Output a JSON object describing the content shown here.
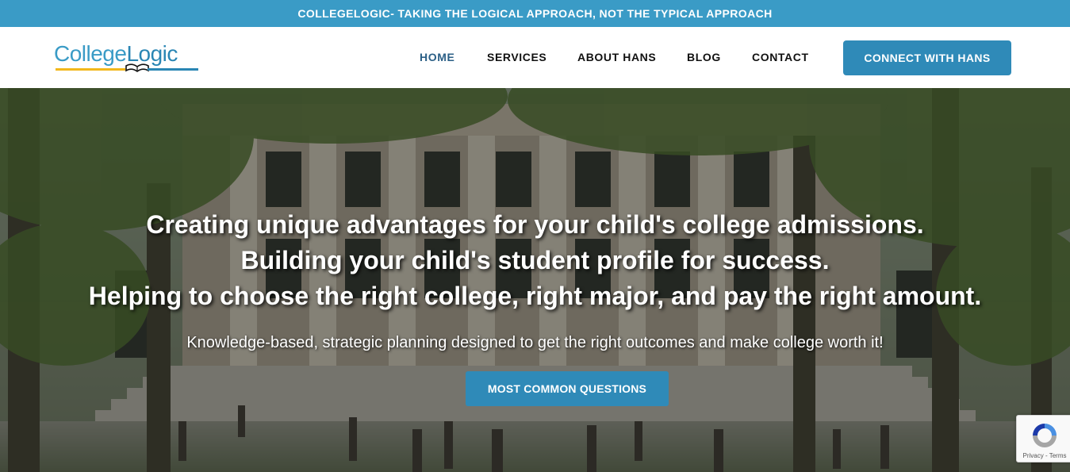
{
  "topbar": {
    "tagline": "COLLEGELOGIC- TAKING THE LOGICAL APPROACH, NOT THE TYPICAL APPROACH"
  },
  "logo": {
    "part1": "College",
    "part2": "Logic"
  },
  "nav": {
    "items": [
      {
        "label": "HOME",
        "active": true
      },
      {
        "label": "SERVICES"
      },
      {
        "label": "ABOUT HANS"
      },
      {
        "label": "BLOG"
      },
      {
        "label": "CONTACT"
      }
    ],
    "cta_label": "CONNECT WITH HANS"
  },
  "hero": {
    "headline_1": "Creating unique advantages for your child's college admissions.",
    "headline_2": "Building your child's student profile for success.",
    "headline_3": "Helping to choose the right college, right major, and pay the right amount.",
    "subheadline": "Knowledge-based, strategic planning designed to get the right outcomes and make college worth it!",
    "button_label": "MOST COMMON QUESTIONS"
  },
  "recaptcha": {
    "links": "Privacy - Terms",
    "icon": "recaptcha-icon"
  },
  "colors": {
    "brand_blue": "#3a9bc6",
    "button_blue": "#2f8ab8",
    "logo_yellow": "#f2b81c",
    "nav_active": "#2b5f86"
  }
}
